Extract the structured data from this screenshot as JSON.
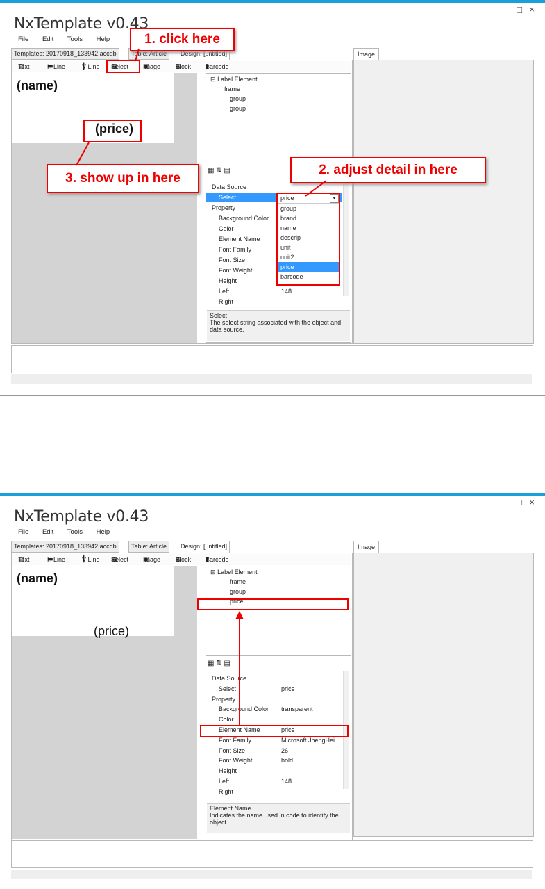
{
  "app": {
    "title": "NxTemplate v0.43",
    "window_controls": [
      "–",
      "□",
      "×"
    ]
  },
  "menu": [
    "File",
    "Edit",
    "Tools",
    "Help"
  ],
  "tabs": {
    "templates": "Templates: 20170918_133942.accdb",
    "table": "Table: Article",
    "design": "Design: [untitled]",
    "image": "Image"
  },
  "toolbar": [
    "Text",
    "H Line",
    "V Line",
    "Select",
    "Image",
    "Block",
    "Barcode"
  ],
  "canvas": {
    "name_label": "(name)",
    "price_label": "(price)"
  },
  "panel1": {
    "tree": {
      "root": "Label Element",
      "children": [
        "frame",
        "group",
        "group"
      ]
    },
    "props": {
      "category_data": "Data Source",
      "select_key": "Select",
      "select_value": "price",
      "category_prop": "Property",
      "rows": [
        "Background Color",
        "Color",
        "Element Name",
        "Font Family",
        "Font Size",
        "Font Weight",
        "Height",
        "Left",
        "Right"
      ],
      "left_value": "148"
    },
    "dropdown": [
      "group",
      "brand",
      "name",
      "descrip",
      "unit",
      "unit2",
      "price",
      "barcode"
    ],
    "help": {
      "title": "Select",
      "text": "The select string associated with the object and data source."
    },
    "callouts": {
      "c1": "1. click here",
      "c2": "2. adjust detail in here",
      "c3": "3. show up in here"
    }
  },
  "panel2": {
    "tree": {
      "root": "Label Element",
      "children": [
        "frame",
        "group",
        "price"
      ]
    },
    "props": {
      "category_data": "Data Source",
      "category_prop": "Property",
      "rows": [
        {
          "k": "Select",
          "v": "price"
        },
        {
          "k": "Background Color",
          "v": "transparent"
        },
        {
          "k": "Color",
          "v": ""
        },
        {
          "k": "Element Name",
          "v": "price"
        },
        {
          "k": "Font Family",
          "v": "Microsoft JhengHei"
        },
        {
          "k": "Font Size",
          "v": "26"
        },
        {
          "k": "Font Weight",
          "v": "bold"
        },
        {
          "k": "Height",
          "v": ""
        },
        {
          "k": "Left",
          "v": "148"
        },
        {
          "k": "Right",
          "v": ""
        }
      ]
    },
    "help": {
      "title": "Element Name",
      "text": "Indicates the name used in code to identify the object."
    }
  },
  "colors": {
    "accent": "#1aa0d8",
    "callout_red": "#e00000",
    "selection": "#3399ff"
  }
}
